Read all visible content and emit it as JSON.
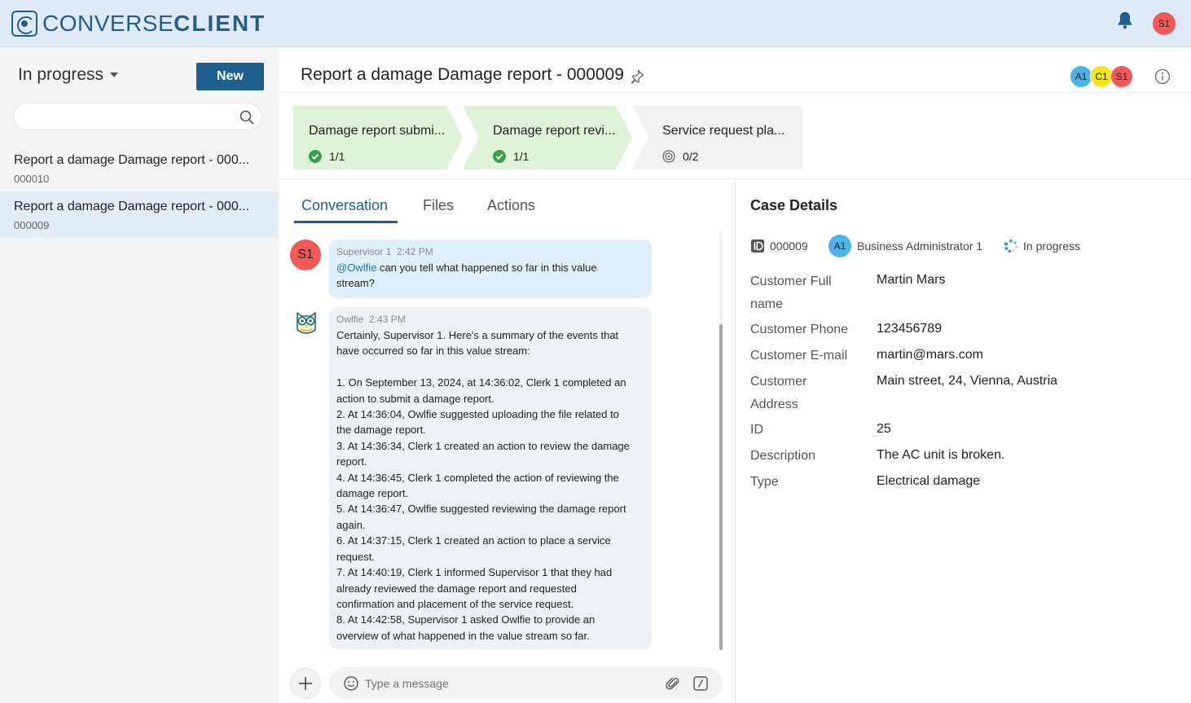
{
  "header": {
    "logo_prefix": "CONVERSE",
    "logo_suffix": "CLIENT",
    "user_initials": "S1"
  },
  "sidebar": {
    "filter_label": "In progress",
    "new_button": "New",
    "search_placeholder": "",
    "items": [
      {
        "title": "Report a damage Damage report - 000...",
        "number": "000010"
      },
      {
        "title": "Report a damage Damage report - 000...",
        "number": "000009"
      }
    ]
  },
  "case": {
    "title": "Report a damage Damage report - 000009",
    "participants": [
      {
        "initials": "A1",
        "color": "#4db3e6"
      },
      {
        "initials": "C1",
        "color": "#f5e617"
      },
      {
        "initials": "S1",
        "color": "#f25a5a"
      }
    ],
    "stages": [
      {
        "name": "Damage report submi...",
        "count": "1/1",
        "status": "done"
      },
      {
        "name": "Damage report revi...",
        "count": "1/1",
        "status": "done"
      },
      {
        "name": "Service request pla...",
        "count": "0/2",
        "status": "pending"
      }
    ]
  },
  "tabs": {
    "conversation": "Conversation",
    "files": "Files",
    "actions": "Actions"
  },
  "conversation": {
    "messages": [
      {
        "sender": "Supervisor 1",
        "time": "2:42 PM",
        "avatar": "S1",
        "mention": "@Owlfie",
        "text": " can you tell what happened so far in this value\nstream?"
      },
      {
        "sender": "Owlfie",
        "time": "2:43 PM",
        "text": "Certainly, Supervisor 1. Here's a summary of the events that\nhave occurred so far in this value stream:\n\n1. On September 13, 2024, at 14:36:02, Clerk 1 completed an\naction to submit a damage report.\n2. At 14:36:04, Owlfie suggested uploading the file related to\nthe damage report.\n3. At 14:36:34, Clerk 1 created an action to review the damage\nreport.\n4. At 14:36:45, Clerk 1 completed the action of reviewing the\ndamage report.\n5. At 14:36:47, Owlfie suggested reviewing the damage report\nagain.\n6. At 14:37:15, Clerk 1 created an action to place a service\nrequest.\n7. At 14:40:19, Clerk 1 informed Supervisor 1 that they had\nalready reviewed the damage report and requested\nconfirmation and placement of the service request.\n8. At 14:42:58, Supervisor 1 asked Owlfie to provide an\noverview of what happened in the value stream so far."
      }
    ],
    "composer_placeholder": "Type a message"
  },
  "details": {
    "title": "Case Details",
    "id": "000009",
    "assignee_initials": "A1",
    "assignee": "Business Administrator 1",
    "status": "In progress",
    "fields": [
      {
        "label": "Customer Full name",
        "value": "Martin Mars"
      },
      {
        "label": "Customer Phone",
        "value": "123456789"
      },
      {
        "label": "Customer E-mail",
        "value": "martin@mars.com"
      },
      {
        "label": "Customer Address",
        "value": "Main street, 24, Vienna, Austria"
      },
      {
        "label": "ID",
        "value": "25"
      },
      {
        "label": "Description",
        "value": "The AC unit is broken."
      },
      {
        "label": "Type",
        "value": "Electrical damage"
      }
    ]
  },
  "colors": {
    "brand": "#1f5f8e",
    "header_bg": "#dfeaf6",
    "stage_done": "#dff3d9",
    "stage_pending": "#f1f2f3",
    "check_green": "#3aa04a"
  }
}
